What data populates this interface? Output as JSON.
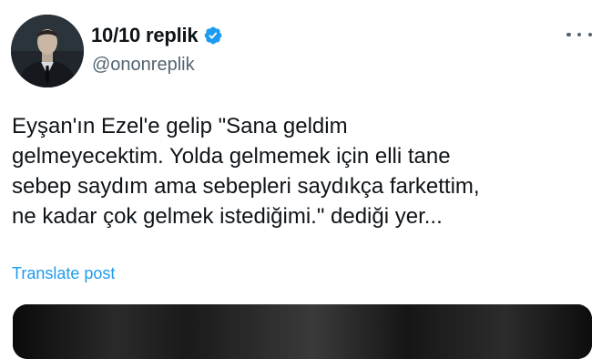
{
  "user": {
    "display_name": "10/10 replik",
    "handle": "@ononreplik",
    "verified": true
  },
  "tweet": {
    "lines": [
      "Eyşan'ın Ezel'e gelip \"Sana geldim",
      "gelmeyecektim. Yolda gelmemek için elli tane",
      "sebep saydım ama sebepleri saydıkça farkettim,",
      "ne kadar çok gelmek istediğimi.\" dediği yer..."
    ],
    "translate_label": "Translate post"
  },
  "icons": {
    "verified": "verified-badge-icon",
    "more": "more-options-icon"
  },
  "colors": {
    "text": "#0f1419",
    "secondary": "#536471",
    "accent": "#1d9bf0"
  }
}
